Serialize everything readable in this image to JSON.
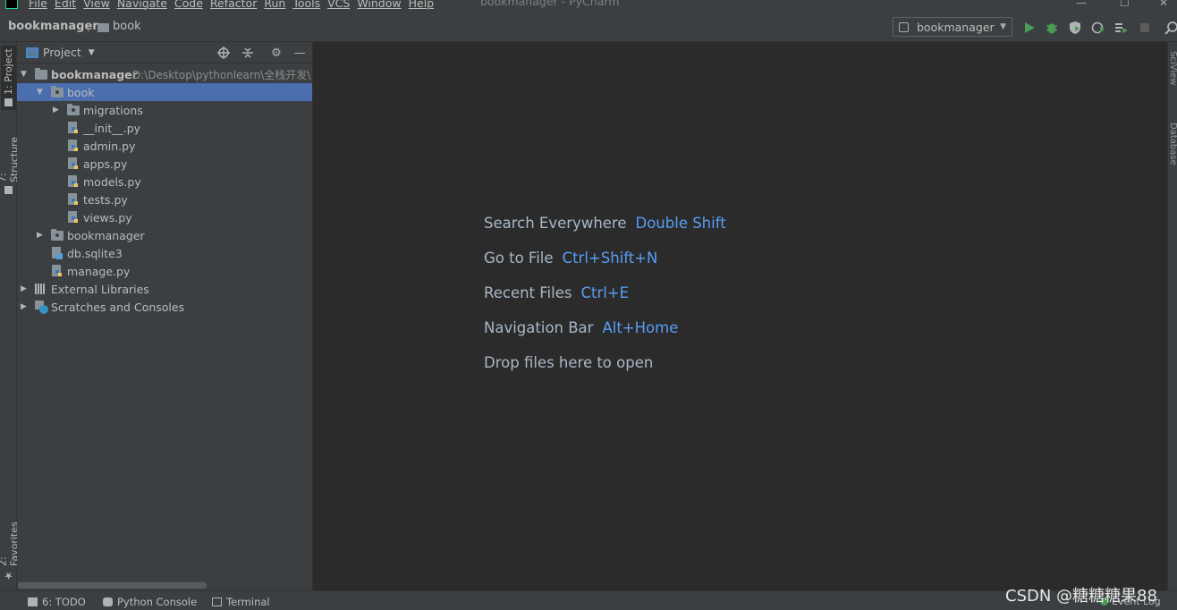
{
  "window": {
    "title": "bookmanager - PyCharm",
    "menu": [
      "File",
      "Edit",
      "View",
      "Navigate",
      "Code",
      "Refactor",
      "Run",
      "Tools",
      "VCS",
      "Window",
      "Help"
    ]
  },
  "navbar": {
    "root": "bookmanager",
    "child": "book",
    "run_config": "bookmanager"
  },
  "left_tabs": [
    "1: Project",
    "7: Structure",
    "2: Favorites"
  ],
  "right_tabs": [
    "SciView",
    "Database"
  ],
  "project_panel": {
    "title": "Project",
    "tree": [
      {
        "label": "bookmanager",
        "path": "D:\\Desktop\\pythonlearn\\全栈开发\\",
        "kind": "folder",
        "bold": true,
        "expanded": true
      },
      {
        "label": "book",
        "kind": "package",
        "expanded": true,
        "selected": true
      },
      {
        "label": "migrations",
        "kind": "package",
        "expanded": false
      },
      {
        "label": "__init__.py",
        "kind": "python"
      },
      {
        "label": "admin.py",
        "kind": "python"
      },
      {
        "label": "apps.py",
        "kind": "python"
      },
      {
        "label": "models.py",
        "kind": "python"
      },
      {
        "label": "tests.py",
        "kind": "python"
      },
      {
        "label": "views.py",
        "kind": "python"
      },
      {
        "label": "bookmanager",
        "kind": "package",
        "expanded": false
      },
      {
        "label": "db.sqlite3",
        "kind": "db"
      },
      {
        "label": "manage.py",
        "kind": "python"
      },
      {
        "label": "External Libraries",
        "kind": "libraries",
        "expanded": false
      },
      {
        "label": "Scratches and Consoles",
        "kind": "scratches",
        "expanded": false
      }
    ]
  },
  "editor_hints": [
    {
      "text": "Search Everywhere",
      "shortcut": "Double Shift"
    },
    {
      "text": "Go to File",
      "shortcut": "Ctrl+Shift+N"
    },
    {
      "text": "Recent Files",
      "shortcut": "Ctrl+E"
    },
    {
      "text": "Navigation Bar",
      "shortcut": "Alt+Home"
    },
    {
      "text": "Drop files here to open",
      "shortcut": ""
    }
  ],
  "statusbar": {
    "todo": "6: TODO",
    "python_console": "Python Console",
    "terminal": "Terminal",
    "event_log": "Event Log"
  },
  "watermark": "CSDN @糖糖糖果88",
  "colors": {
    "background": "#2b2b2b",
    "panel": "#3c3f41",
    "selection": "#4b6eaf",
    "shortcut": "#589df6",
    "run_green": "#499c54"
  }
}
